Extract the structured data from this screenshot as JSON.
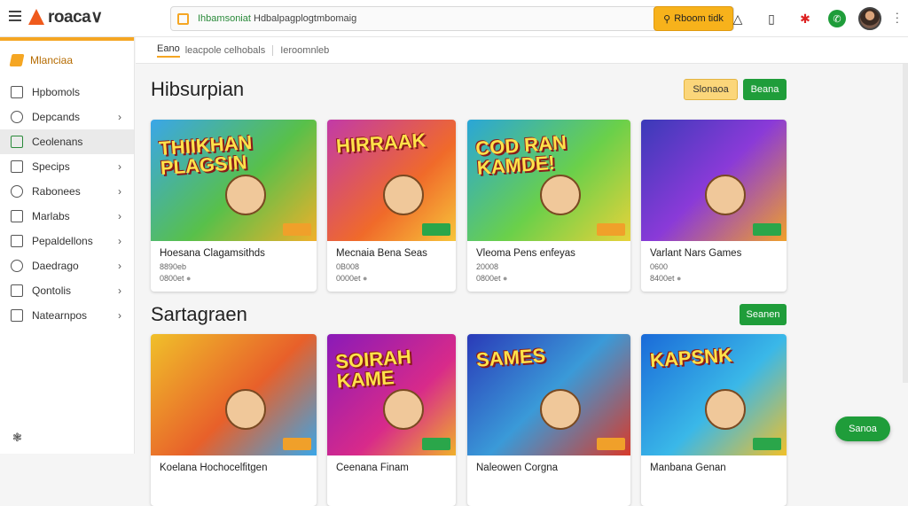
{
  "app": {
    "logo_text": "roaca∨"
  },
  "search": {
    "prefix": "Ihbamsoniat",
    "placeholder": "Hdbalpagplogtmbomaig",
    "button_label": "Rboom tidk"
  },
  "sidebar": {
    "brand": "Mlanciaa",
    "items": [
      {
        "label": "Hpbomols",
        "chevron": false,
        "active": false
      },
      {
        "label": "Depcands",
        "chevron": true,
        "active": false
      },
      {
        "label": "Ceolenans",
        "chevron": false,
        "active": true
      },
      {
        "label": "Specips",
        "chevron": true,
        "active": false
      },
      {
        "label": "Rabonees",
        "chevron": true,
        "active": false
      },
      {
        "label": "Marlabs",
        "chevron": true,
        "active": false
      },
      {
        "label": "Pepaldellons",
        "chevron": true,
        "active": false
      },
      {
        "label": "Daedrago",
        "chevron": true,
        "active": false
      },
      {
        "label": "Qontolis",
        "chevron": true,
        "active": false
      },
      {
        "label": "Natearnpos",
        "chevron": true,
        "active": false
      }
    ]
  },
  "subnav": {
    "tab1": "Eano",
    "tab2": "leacpole celhobals",
    "tab3": "Ieroomnleb"
  },
  "section1": {
    "title": "Hibsurpian",
    "btn_secondary": "Slonaoa",
    "btn_primary": "Beana"
  },
  "section2": {
    "title": "Sartagraen",
    "btn_primary": "Seanen"
  },
  "cards_row1": [
    {
      "art_text": "THIIKHAN PLAGSIN",
      "name": "Hoesana Clagamsithds",
      "meta1": "8890eb",
      "meta2": "0800et"
    },
    {
      "art_text": "HIRRAAK",
      "name": "Mecnaia Bena Seas",
      "meta1": "0B008",
      "meta2": "0000et"
    },
    {
      "art_text": "COD RAN KAMDE!",
      "name": "Vleoma Pens enfeyas",
      "meta1": "20008",
      "meta2": "0800et"
    },
    {
      "art_text": "",
      "name": "Varlant Nars Games",
      "meta1": "0600",
      "meta2": "8400et"
    }
  ],
  "cards_row2": [
    {
      "art_text": "",
      "name": "Koelana Hochocelfitgen"
    },
    {
      "art_text": "SOIRAH KAME",
      "name": "Ceenana Finam"
    },
    {
      "art_text": "SAMES",
      "name": "Naleowen Corgna"
    },
    {
      "art_text": "KAPSNK",
      "name": "Manbana Genan"
    }
  ],
  "fab": {
    "label": "Sanoa"
  },
  "colors": {
    "accent": "#f5a623",
    "green": "#1f9d3a",
    "logo": "#ef5a1c"
  }
}
